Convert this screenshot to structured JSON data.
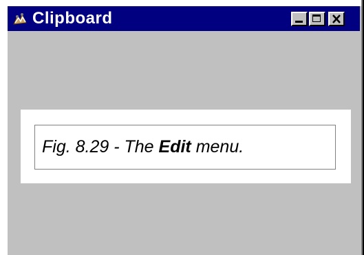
{
  "window": {
    "title": "Clipboard",
    "icon": "clipboard-app-icon",
    "controls": {
      "minimize": "minimize-icon",
      "maximize": "maximize-icon",
      "close": "close-icon"
    }
  },
  "content": {
    "caption": {
      "prefix": "Fig. 8.29 - The ",
      "bold": "Edit",
      "suffix": " menu."
    }
  },
  "colors": {
    "titlebar": "#000080",
    "client": "#c0c0c0",
    "panel": "#ffffff"
  }
}
